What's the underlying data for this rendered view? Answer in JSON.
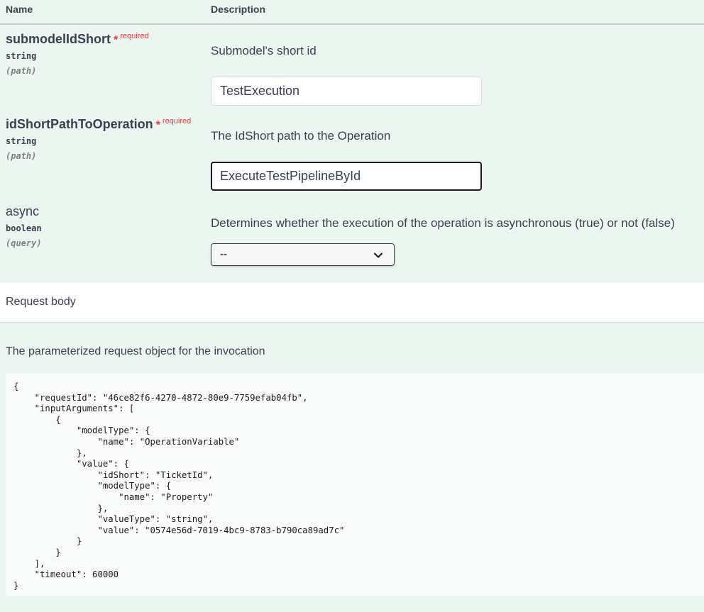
{
  "params_header": {
    "name_col": "Name",
    "desc_col": "Description"
  },
  "parameters": [
    {
      "name": "submodelIdShort",
      "required_marker": "*",
      "required_label": "required",
      "type": "string",
      "location": "(path)",
      "description": "Submodel's short id",
      "value": "TestExecution"
    },
    {
      "name": "idShortPathToOperation",
      "required_marker": "*",
      "required_label": "required",
      "type": "string",
      "location": "(path)",
      "description": "The IdShort path to the Operation",
      "value": "ExecuteTestPipelineById"
    },
    {
      "name": "async",
      "type": "boolean",
      "location": "(query)",
      "description": "Determines whether the execution of the operation is asynchronous (true) or not (false)",
      "selected": "--"
    }
  ],
  "request_body": {
    "label": "Request body",
    "description": "The parameterized request object for the invocation",
    "example": "{\n    \"requestId\": \"46ce82f6-4270-4872-80e9-7759efab04fb\",\n    \"inputArguments\": [\n        {\n            \"modelType\": {\n                \"name\": \"OperationVariable\"\n            },\n            \"value\": {\n                \"idShort\": \"TicketId\",\n                \"modelType\": {\n                    \"name\": \"Property\"\n                },\n                \"valueType\": \"string\",\n                \"value\": \"0574e56d-7019-4bc9-8783-b790ca89ad7c\"\n            }\n        }\n    ],\n    \"timeout\": 60000\n}"
  },
  "icons": {
    "select_arrow": "chevron-down-icon"
  }
}
